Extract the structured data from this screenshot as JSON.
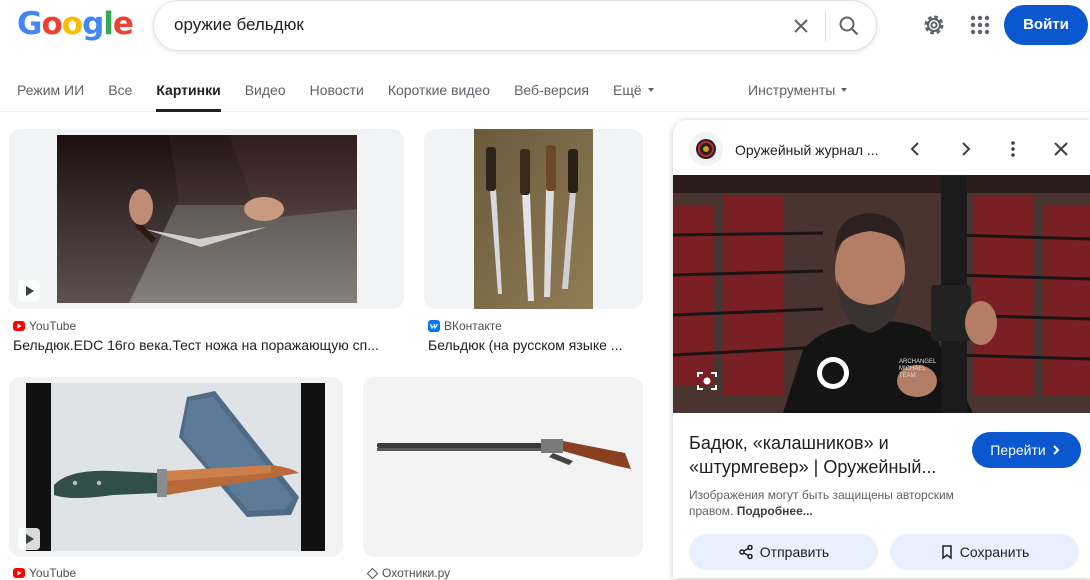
{
  "header": {
    "logo": [
      "G",
      "o",
      "o",
      "g",
      "l",
      "e"
    ],
    "search_value": "оружие бельдюк",
    "signin_label": "Войти"
  },
  "tabs": [
    {
      "label": "Режим ИИ"
    },
    {
      "label": "Все"
    },
    {
      "label": "Картинки",
      "active": true
    },
    {
      "label": "Видео"
    },
    {
      "label": "Новости"
    },
    {
      "label": "Короткие видео"
    },
    {
      "label": "Веб-версия"
    },
    {
      "label": "Ещё"
    }
  ],
  "tools_label": "Инструменты",
  "results": [
    {
      "source": "YouTube",
      "title": "Бельдюк.EDC 16го века.Тест ножа на поражающую сп...",
      "icon": "youtube-icon"
    },
    {
      "source": "ВКонтакте",
      "title": "Бельдюк (на русском языке ...",
      "icon": "vk-icon"
    },
    {
      "source": "YouTube",
      "title": "",
      "icon": "youtube-icon"
    },
    {
      "source": "Охотники.ру",
      "title": "",
      "icon": "site-icon"
    }
  ],
  "panel": {
    "site_name": "Оружейный журнал ...",
    "title_line1": "Бадюк, «калашников» и",
    "title_line2": "«штурмгевер» | Оружейный...",
    "visit_label": "Перейти",
    "copyright_text": "Изображения могут быть защищены авторским правом.",
    "more_link": "Подробнее...",
    "share_label": "Отправить",
    "save_label": "Сохранить",
    "shirt_text": [
      "ARCHANGEL",
      "MICHAEL",
      "TEAM"
    ]
  },
  "colors": {
    "accent": "#0b57d0",
    "youtube": "#ff0000",
    "vk": "#0077ff"
  }
}
